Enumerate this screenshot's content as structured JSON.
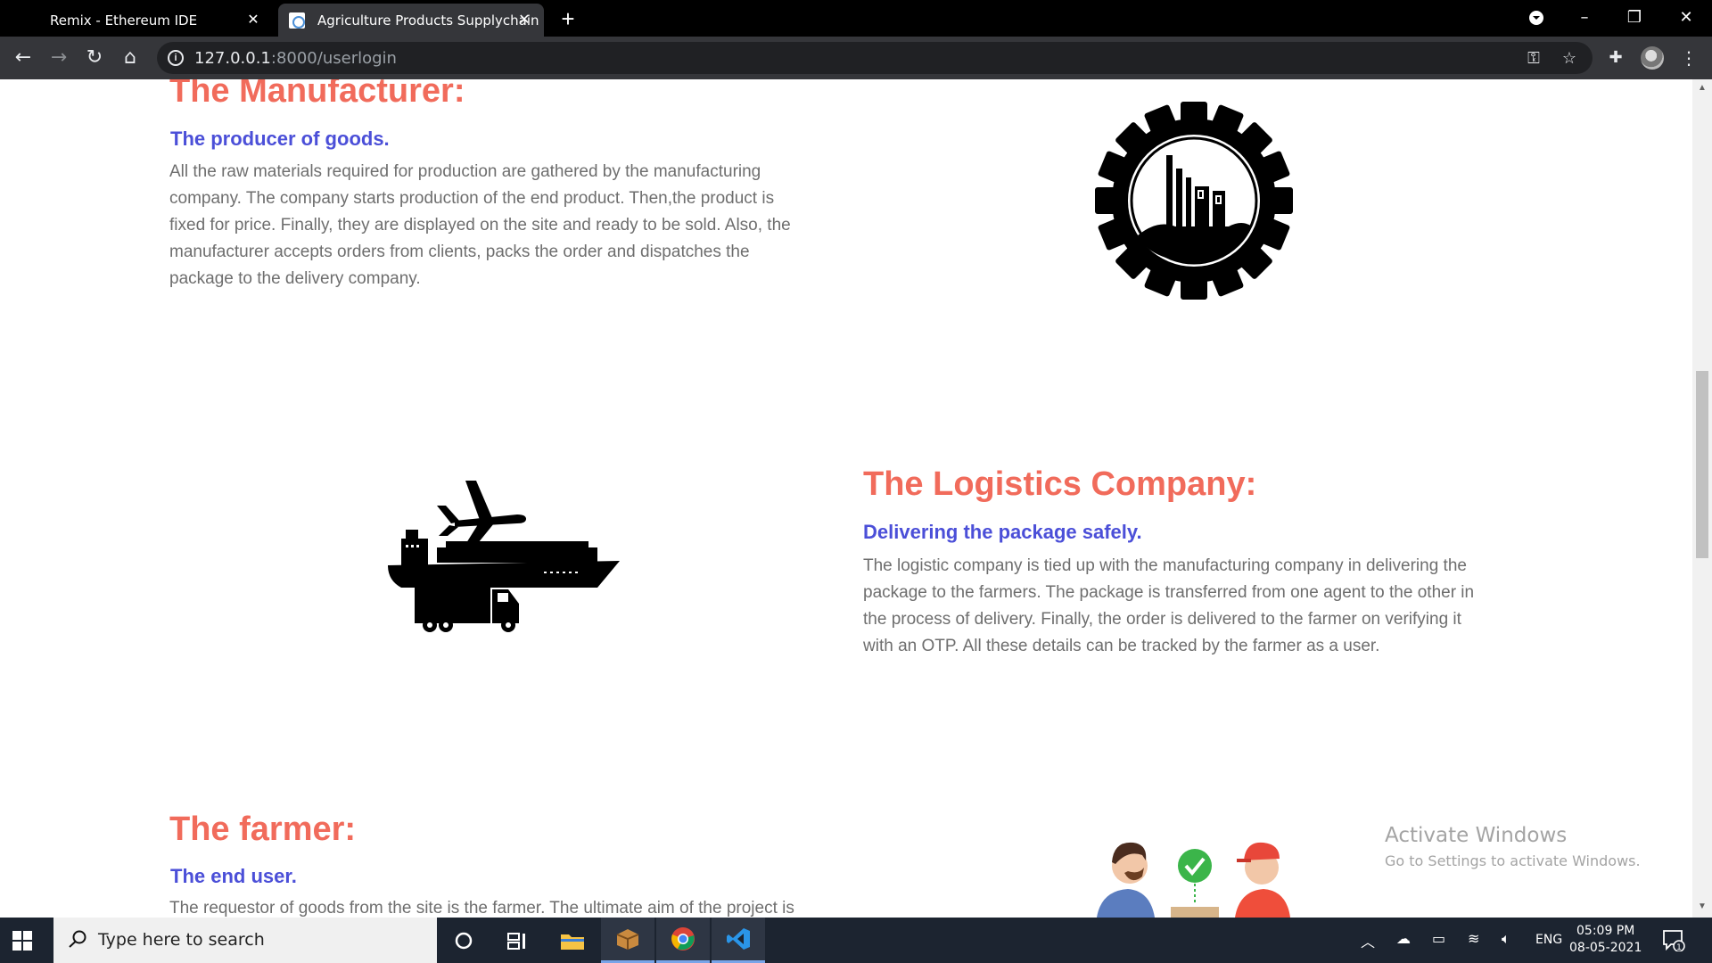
{
  "browser": {
    "tabs": [
      {
        "title": "Remix - Ethereum IDE",
        "active": false
      },
      {
        "title": "Agriculture Products Supplychain",
        "active": true
      }
    ],
    "url_host": "127.0.0.1",
    "url_rest": ":8000/userlogin"
  },
  "sections": {
    "manufacturer": {
      "title": "The Manufacturer:",
      "subtitle": "The producer of goods.",
      "lines": [
        "All the raw materials required for production are gathered by the manufacturing",
        "company. The company starts production of the end product. Then,the product is",
        "fixed for price. Finally, they are displayed on the site and ready to be sold. Also, the",
        "manufacturer accepts orders from clients, packs the order and dispatches the",
        "package to the delivery company."
      ]
    },
    "logistics": {
      "title": "The Logistics Company:",
      "subtitle": "Delivering the package safely.",
      "lines": [
        "The logistic company is tied up with the manufacturing company in delivering the",
        "package to the farmers. The package is transferred from one agent to the other in",
        "the process of delivery. Finally, the order is delivered to the farmer on verifying it",
        "with an OTP. All these details can be tracked by the farmer as a user."
      ]
    },
    "farmer": {
      "title": "The farmer:",
      "subtitle": "The end user.",
      "lines": [
        "The requestor of goods from the site is the farmer. The ultimate aim of the project is"
      ]
    }
  },
  "watermark": {
    "title": "Activate Windows",
    "subtitle": "Go to Settings to activate Windows."
  },
  "taskbar": {
    "search_placeholder": "Type here to search",
    "language": "ENG",
    "time": "05:09 PM",
    "date": "08-05-2021",
    "notification_count": "1"
  },
  "colors": {
    "title": "#f16b5b",
    "subtitle": "#4b4fd8",
    "body": "#6e6e6e"
  }
}
